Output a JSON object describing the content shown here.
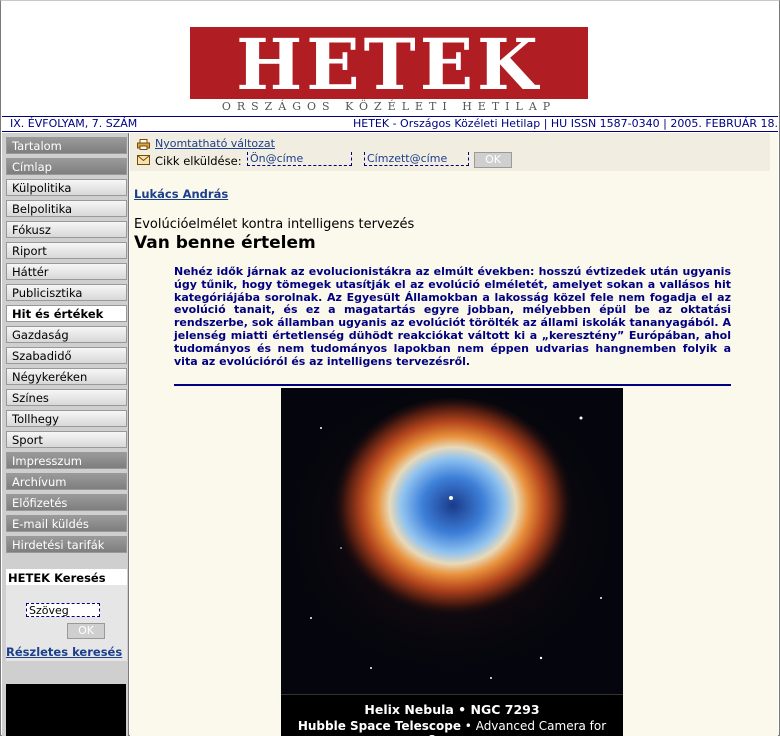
{
  "masthead": {
    "logo": "HETEK",
    "subtitle": "ORSZÁGOS KÖZÉLETI HETILAP"
  },
  "strip": {
    "issue": "IX. ÉVFOLYAM, 7. SZÁM",
    "info": "HETEK - Országos Közéleti Hetilap | HU ISSN 1587-0340 | 2005. FEBRUÁR 18."
  },
  "menu": [
    {
      "label": "Tartalom",
      "style": "dark"
    },
    {
      "label": "Címlap",
      "style": "dark"
    },
    {
      "label": "Külpolitika",
      "style": "light"
    },
    {
      "label": "Belpolitika",
      "style": "light"
    },
    {
      "label": "Fókusz",
      "style": "light"
    },
    {
      "label": "Riport",
      "style": "light"
    },
    {
      "label": "Háttér",
      "style": "light"
    },
    {
      "label": "Publicisztika",
      "style": "light"
    },
    {
      "label": "Hit és értékek",
      "style": "active"
    },
    {
      "label": "Gazdaság",
      "style": "light"
    },
    {
      "label": "Szabadidő",
      "style": "light"
    },
    {
      "label": "Négykeréken",
      "style": "light"
    },
    {
      "label": "Színes",
      "style": "light"
    },
    {
      "label": "Tollhegy",
      "style": "light"
    },
    {
      "label": "Sport",
      "style": "light"
    },
    {
      "label": "Impresszum",
      "style": "dark"
    },
    {
      "label": "Archívum",
      "style": "dark"
    },
    {
      "label": "Előfizetés",
      "style": "dark"
    },
    {
      "label": "E-mail küldés",
      "style": "dark"
    },
    {
      "label": "Hirdetési tarifák",
      "style": "dark"
    }
  ],
  "search": {
    "title": "HETEK Keresés",
    "placeholder": "Szöveg",
    "ok": "OK",
    "advanced": "Részletes keresés"
  },
  "toolbar": {
    "print": "Nyomtatható változat",
    "send_label": "Cikk elküldése:",
    "from_value": "Ön@címe",
    "to_value": "Címzett@címe",
    "ok": "OK"
  },
  "article": {
    "author": "Lukács András",
    "kicker": "Evolúcióelmélet kontra intelligens tervezés",
    "title": "Van benne értelem",
    "lead": "Nehéz idők járnak az evolucionistákra az elmúlt években: hosszú évtizedek után ugyanis úgy tűnik, hogy tömegek utasítják el az evolúció elméletét, amelyet sokan a vallásos hit kategóriájába sorolnak. Az Egyesült Államokban a lakosság közel fele nem fogadja el az evolúció tanait, és ez a magatartás egyre jobban, mélyebben épül be az oktatási rendszerbe, sok államban ugyanis az evolúciót törölték az állami iskolák tananyagából. A jelenség miatti értetlenség dühödt reakciókat váltott ki a „keresztény” Európában, ahol tudományos és nem tudományos lapokban nem éppen udvarias hangnemben folyik a vita az evolúcióról és az intelligens tervezésről.",
    "caption1": "Helix Nebula • NGC 7293",
    "caption2_bold": "Hubble Space Telescope",
    "caption2_rest": " • Advanced Camera for Surveys"
  },
  "colors": {
    "brand_red": "#b01e24",
    "navy": "#000080",
    "link": "#1b3f8c"
  }
}
